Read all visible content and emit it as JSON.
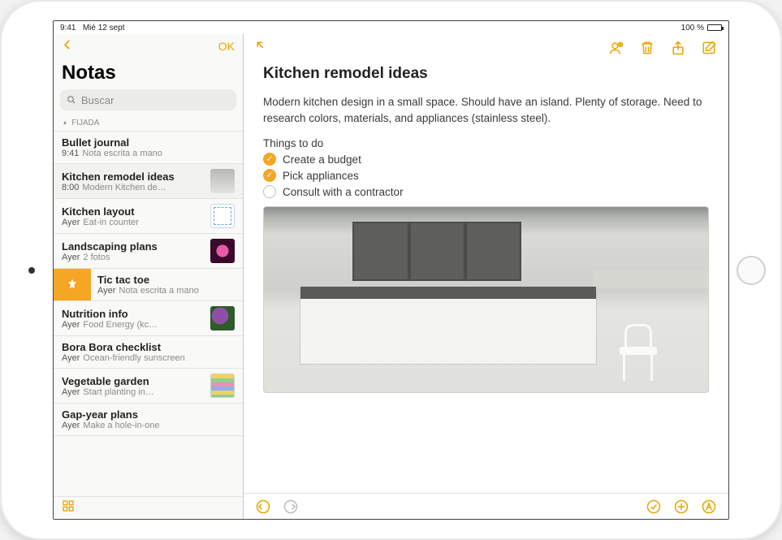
{
  "accent_color": "#e6a500",
  "statusbar": {
    "time": "9:41",
    "date": "Mié 12 sept",
    "battery_pct": "100 %"
  },
  "sidebar": {
    "back_label": "",
    "ok_label": "OK",
    "title": "Notas",
    "search_placeholder": "Buscar",
    "pinned_section": "FIJADA",
    "items": [
      {
        "title": "Bullet journal",
        "time": "9:41",
        "preview": "Nota escrita a mano",
        "thumb": null,
        "pinned_swipe": false,
        "selected": false
      },
      {
        "title": "Kitchen remodel ideas",
        "time": "8:00",
        "preview": "Modern Kitchen de…",
        "thumb": "kitchen",
        "pinned_swipe": false,
        "selected": true
      },
      {
        "title": "Kitchen layout",
        "time": "Ayer",
        "preview": "Eat-in counter",
        "thumb": "diagram",
        "pinned_swipe": false,
        "selected": false
      },
      {
        "title": "Landscaping plans",
        "time": "Ayer",
        "preview": "2 fotos",
        "thumb": "flower",
        "pinned_swipe": false,
        "selected": false
      },
      {
        "title": "Tic tac toe",
        "time": "Ayer",
        "preview": "Nota escrita a mano",
        "thumb": null,
        "pinned_swipe": true,
        "selected": false
      },
      {
        "title": "Nutrition info",
        "time": "Ayer",
        "preview": "Food Energy (kc…",
        "thumb": "veggie",
        "pinned_swipe": false,
        "selected": false
      },
      {
        "title": "Bora Bora checklist",
        "time": "Ayer",
        "preview": "Ocean-friendly sunscreen",
        "thumb": null,
        "pinned_swipe": false,
        "selected": false
      },
      {
        "title": "Vegetable garden",
        "time": "Ayer",
        "preview": "Start planting in…",
        "thumb": "stripes",
        "pinned_swipe": false,
        "selected": false
      },
      {
        "title": "Gap-year plans",
        "time": "Ayer",
        "preview": "Make a hole-in-one",
        "thumb": null,
        "pinned_swipe": false,
        "selected": false
      }
    ]
  },
  "note": {
    "title": "Kitchen remodel ideas",
    "body": "Modern kitchen design in a small space. Should have an island. Plenty of storage. Need to research colors, materials, and appliances (stainless steel).",
    "todo_header": "Things to do",
    "todos": [
      {
        "label": "Create a budget",
        "done": true
      },
      {
        "label": "Pick appliances",
        "done": true
      },
      {
        "label": "Consult with a contractor",
        "done": false
      }
    ]
  }
}
